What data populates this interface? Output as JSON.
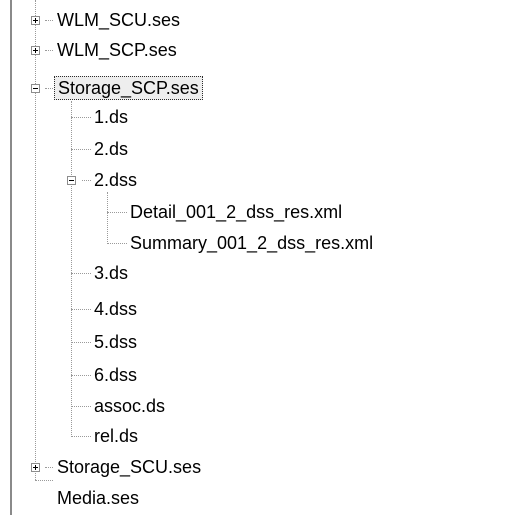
{
  "tree": {
    "items": [
      {
        "label": "WLM_SCU.ses",
        "expander": "plus"
      },
      {
        "label": "WLM_SCP.ses",
        "expander": "plus"
      },
      {
        "label": "Storage_SCP.ses",
        "expander": "minus",
        "selected": true
      },
      {
        "label": "1.ds"
      },
      {
        "label": "2.ds"
      },
      {
        "label": "2.dss",
        "expander": "minus"
      },
      {
        "label": "Detail_001_2_dss_res.xml"
      },
      {
        "label": "Summary_001_2_dss_res.xml"
      },
      {
        "label": "3.ds"
      },
      {
        "label": "4.dss"
      },
      {
        "label": "5.dss"
      },
      {
        "label": "6.dss"
      },
      {
        "label": "assoc.ds"
      },
      {
        "label": "rel.ds"
      },
      {
        "label": "Storage_SCU.ses",
        "expander": "plus"
      },
      {
        "label": "Media.ses"
      }
    ]
  }
}
